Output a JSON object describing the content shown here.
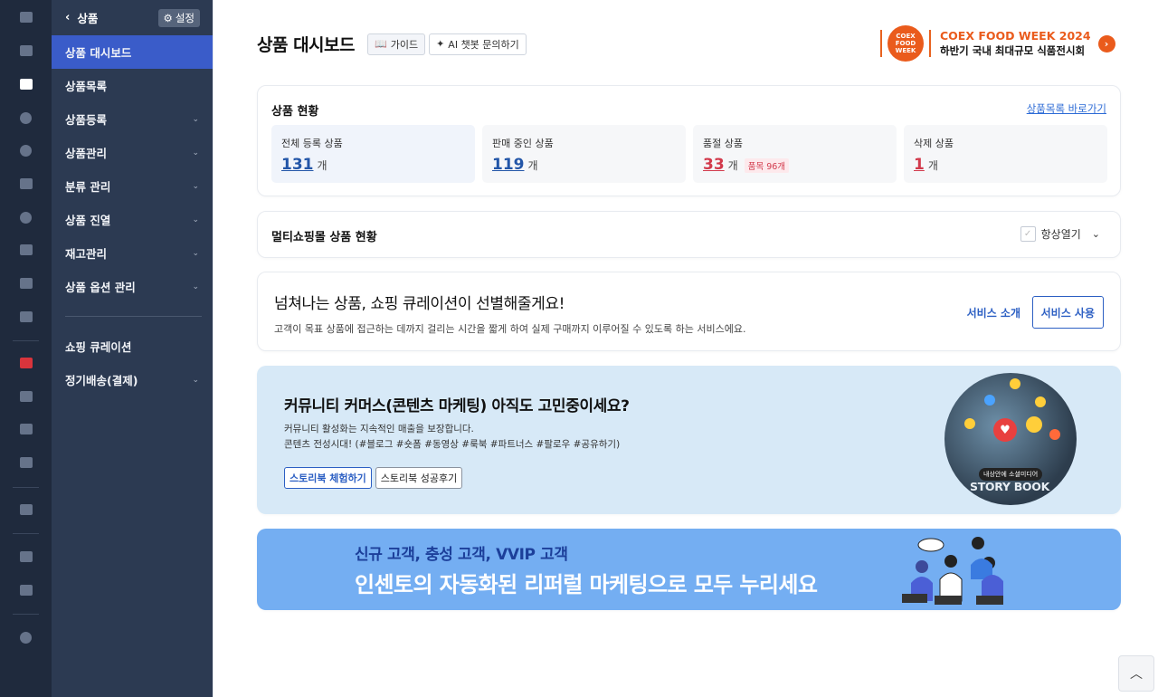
{
  "sidebar": {
    "back_label": "상품",
    "settings_label": "설정",
    "items": [
      {
        "label": "상품 대시보드",
        "active": true,
        "has_sub": false
      },
      {
        "label": "상품목록",
        "active": false,
        "has_sub": false
      },
      {
        "label": "상품등록",
        "active": false,
        "has_sub": true
      },
      {
        "label": "상품관리",
        "active": false,
        "has_sub": true
      },
      {
        "label": "분류 관리",
        "active": false,
        "has_sub": true
      },
      {
        "label": "상품 진열",
        "active": false,
        "has_sub": true
      },
      {
        "label": "재고관리",
        "active": false,
        "has_sub": true
      },
      {
        "label": "상품 옵션 관리",
        "active": false,
        "has_sub": true
      }
    ],
    "items2": [
      {
        "label": "쇼핑 큐레이션",
        "has_sub": false
      },
      {
        "label": "정기배송(결제)",
        "has_sub": true
      }
    ]
  },
  "header": {
    "title": "상품 대시보드",
    "guide_label": "가이드",
    "ai_label": "AI 챗봇 문의하기"
  },
  "coex": {
    "logo_text": "COEX FOOD WEEK",
    "title": "COEX FOOD WEEK 2024",
    "subtitle": "하반기 국내 최대규모 식품전시회"
  },
  "status": {
    "title": "상품 현황",
    "link": "상품목록 바로가기",
    "unit": "개",
    "cards": [
      {
        "label": "전체 등록 상품",
        "value": "131"
      },
      {
        "label": "판매 중인 상품",
        "value": "119"
      },
      {
        "label": "품절 상품",
        "value": "33",
        "badge": "품목 96개"
      },
      {
        "label": "삭제 상품",
        "value": "1"
      }
    ]
  },
  "multi": {
    "title": "멀티쇼핑몰 상품 현황",
    "toggle_label": "항상열기"
  },
  "curation": {
    "title": "넘쳐나는 상품, 쇼핑 큐레이션이 선별해줄게요!",
    "desc": "고객이 목표 상품에 접근하는 데까지 걸리는 시간을 짧게 하여 실제 구매까지 이루어질 수 있도록 하는 서비스에요.",
    "intro_label": "서비스 소개",
    "use_label": "서비스 사용"
  },
  "storybook": {
    "title": "커뮤니티 커머스(콘텐츠 마케팅) 아직도 고민중이세요?",
    "desc1": "커뮤니티 활성화는 지속적인 매출을 보장합니다.",
    "desc2": "콘텐츠 전성시대! (#블로그 #숏폼 #동영상 #룩북 #파트너스 #팔로우 #공유하기)",
    "btn_try": "스토리북 체험하기",
    "btn_review": "스토리북 성공후기",
    "img_label": "내상안에 소셜미디어",
    "img_name": "STORY BOOK"
  },
  "referral": {
    "line1": "신규 고객, 충성 고객, VVIP 고객",
    "line2": "인센토의 자동화된 리퍼럴 마케팅으로 모두 누리세요"
  },
  "icons": {
    "rail": [
      "home-icon",
      "cart-icon",
      "shirt-icon",
      "user-icon",
      "chat-icon",
      "board-icon",
      "palette-icon",
      "mail-icon",
      "chart-icon",
      "excel-icon",
      "youtube-icon",
      "bag-icon",
      "megaphone-icon",
      "store-icon",
      "truck-icon",
      "apps-icon",
      "folder-icon",
      "gear-icon"
    ]
  },
  "colors": {
    "accent": "#3a5cc9",
    "link": "#2c6bd6",
    "danger": "#d23a4c",
    "coex": "#ea5b1c"
  }
}
